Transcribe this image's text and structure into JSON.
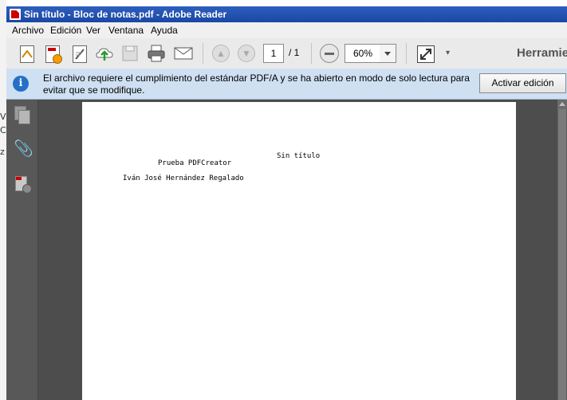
{
  "window": {
    "title": "Sin título - Bloc de notas.pdf - Adobe Reader"
  },
  "menu": [
    "Archivo",
    "Edición",
    "Ver",
    "Ventana",
    "Ayuda"
  ],
  "toolbar": {
    "icons": [
      "create-pdf-icon",
      "convert-pdf-icon",
      "sign-icon",
      "upload-icon",
      "save-icon",
      "print-icon",
      "email-icon",
      "previous-page-icon",
      "next-page-icon",
      "zoom-out-icon",
      "fullscreen-icon"
    ],
    "page_current": "1",
    "page_total": "/ 1",
    "zoom_value": "60%",
    "tools_label": "Herramie"
  },
  "infobar": {
    "message": "El archivo requiere el cumplimiento del estándar PDF/A y se ha abierto en modo de solo lectura para evitar que se modifique.",
    "button": "Activar edición",
    "info_glyph": "i"
  },
  "document": {
    "title": "Sin título",
    "line1": "Prueba PDFCreator",
    "line2": "Iván José Hernández Regalado"
  },
  "background_window_fragments": [
    "V",
    "C",
    "z"
  ]
}
